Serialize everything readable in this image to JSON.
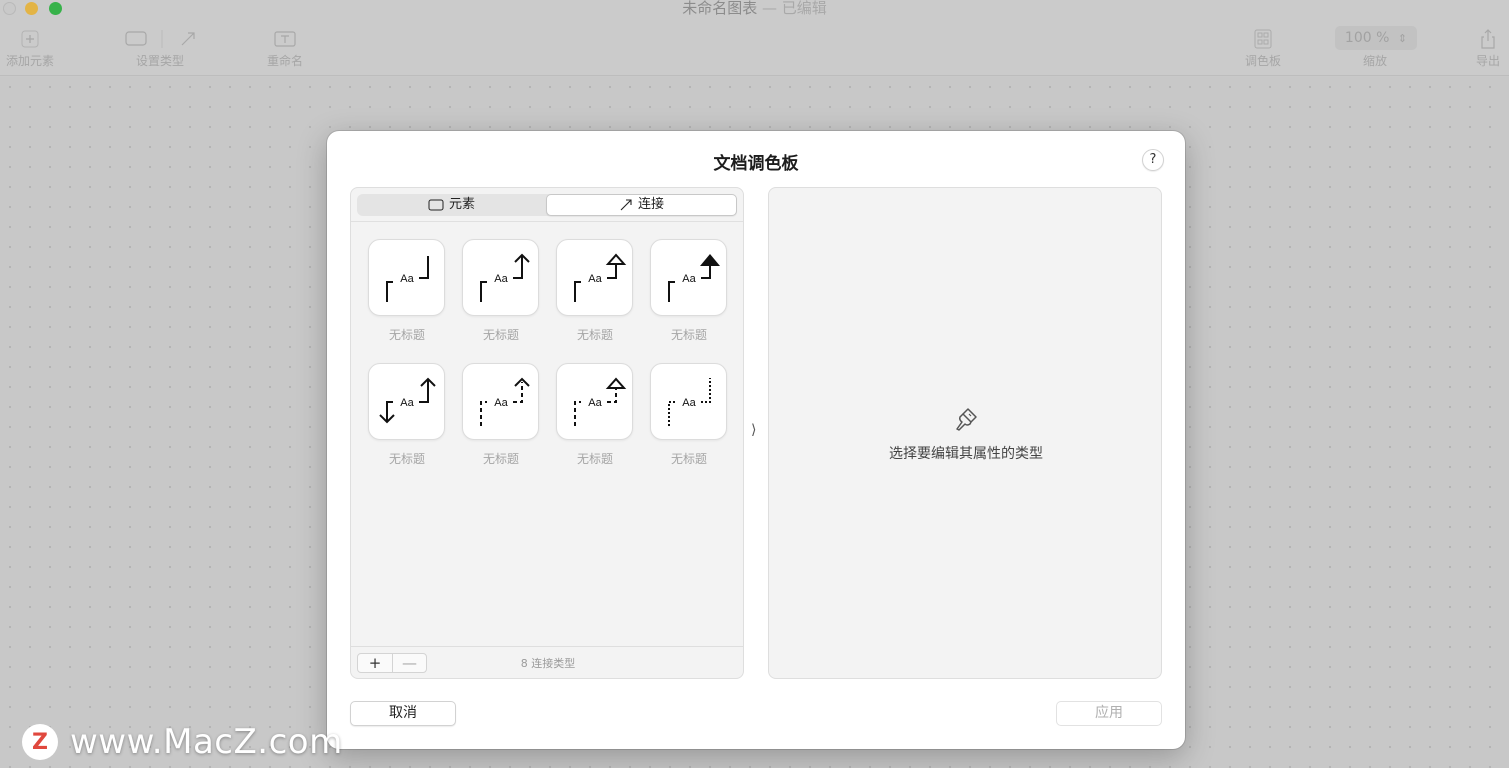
{
  "window": {
    "title": "未命名图表",
    "separator": "—",
    "edited": "已编辑"
  },
  "toolbar": {
    "add_element": "添加元素",
    "set_type": "设置类型",
    "rename": "重命名",
    "palette": "调色板",
    "zoom_value": "100 %",
    "zoom_label": "缩放",
    "export": "导出"
  },
  "sheet": {
    "title": "文档调色板",
    "help": "?",
    "segments": [
      {
        "label": "元素",
        "selected": false
      },
      {
        "label": "连接",
        "selected": true
      }
    ],
    "tiles": [
      {
        "label": "无标题",
        "icon": "connection-plain-icon"
      },
      {
        "label": "无标题",
        "icon": "connection-arrow-icon"
      },
      {
        "label": "无标题",
        "icon": "connection-open-arrow-icon"
      },
      {
        "label": "无标题",
        "icon": "connection-filled-arrow-icon"
      },
      {
        "label": "无标题",
        "icon": "connection-bidirectional-icon"
      },
      {
        "label": "无标题",
        "icon": "connection-dashed-arrow-icon"
      },
      {
        "label": "无标题",
        "icon": "connection-dashed-open-arrow-icon"
      },
      {
        "label": "无标题",
        "icon": "connection-dotted-icon"
      }
    ],
    "footer_add": "+",
    "footer_remove": "—",
    "count_text": "8 连接类型",
    "collapse_glyph": "⟩",
    "empty_text": "选择要编辑其属性的类型",
    "cancel": "取消",
    "apply": "应用"
  },
  "watermark": {
    "logo": "Z",
    "text": "www.MacZ.com"
  },
  "colors": {
    "accent_green": "#37b24a",
    "accent_yellow": "#e3b446",
    "watermark_red": "#e0483e"
  }
}
